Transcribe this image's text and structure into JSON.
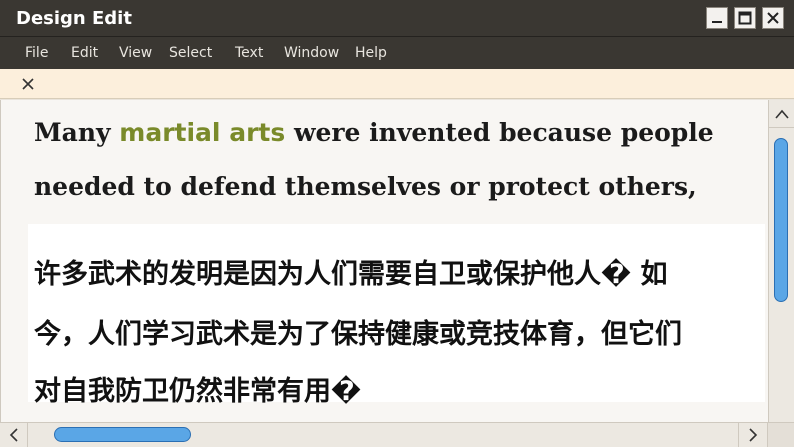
{
  "window": {
    "title": "Design Edit",
    "title_bar_color": "#3a3732"
  },
  "menu": {
    "items": [
      "File",
      "Edit",
      "View",
      "Select",
      "Text",
      "Window",
      "Help"
    ]
  },
  "findbar": {
    "background": "#fcefdc",
    "close_icon": "close-icon"
  },
  "document": {
    "english": {
      "line1_before": "Many ",
      "line1_highlight": "martial arts",
      "line1_after": " were invented because people",
      "line2": "needed to defend themselves or protect others,",
      "highlight_color": "#7a8a2a"
    },
    "chinese": {
      "line1": "许多武术的发明是因为人们需要自卫或保护他人� 如",
      "line2": "今，人们学习武术是为了保持健康或竞技体育，但它们",
      "line3": "对自我防卫仍然非常有用�"
    }
  },
  "scrollbars": {
    "accent": "#5aa6e6",
    "up_icon": "chevron-up-icon",
    "left_icon": "chevron-left-icon",
    "right_icon": "chevron-right-icon"
  }
}
